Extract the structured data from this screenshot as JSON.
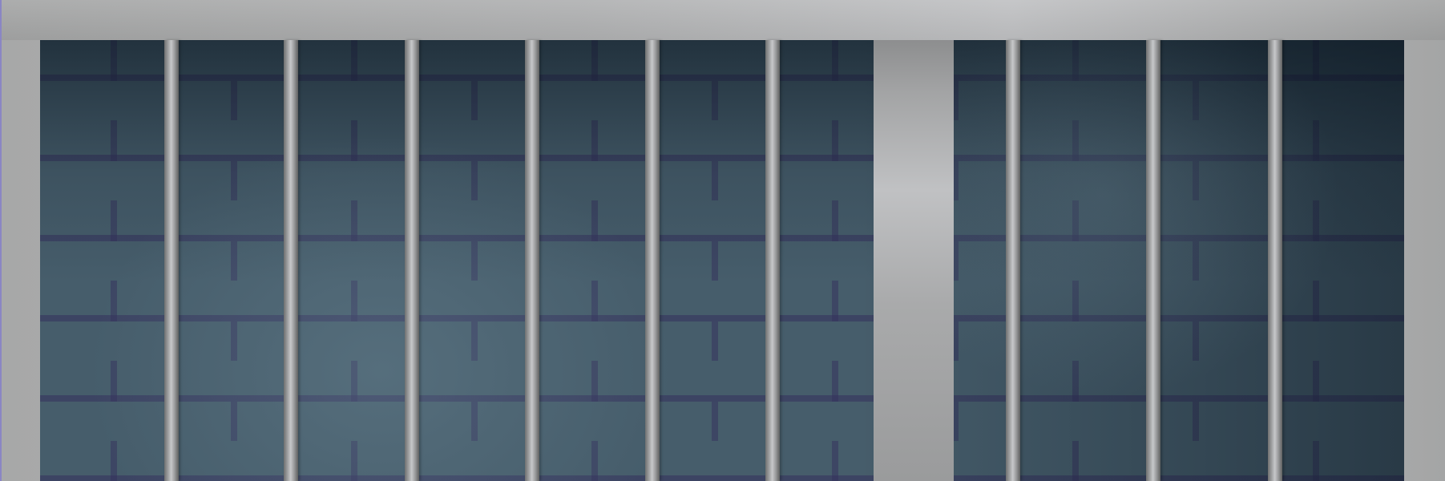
{
  "scene": {
    "type": "jail-cell",
    "frame_color": "#b2b3b4",
    "wall_color": "#465d6b",
    "mortar_color": "#34305c",
    "bar_color": "#9c9d9e",
    "bar_count": 10,
    "has_center_post": true
  }
}
